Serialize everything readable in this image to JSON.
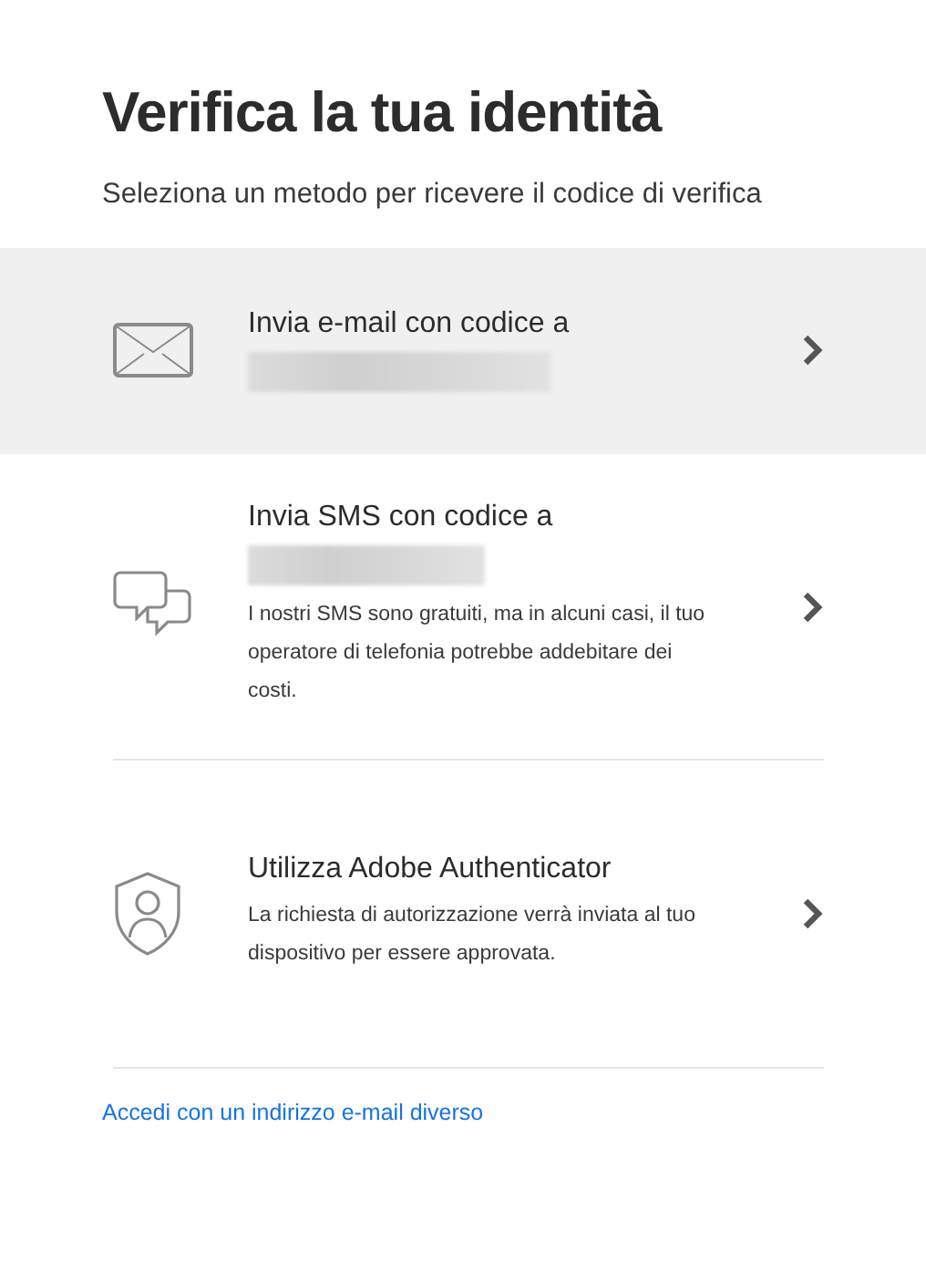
{
  "title": "Verifica la tua identità",
  "subtitle": "Seleziona un metodo per ricevere il codice di verifica",
  "options": [
    {
      "kind": "email",
      "selected": true,
      "label": "Invia e-mail con codice a",
      "redacted": true
    },
    {
      "kind": "sms",
      "selected": false,
      "label": "Invia SMS con codice a",
      "redacted": true,
      "note": "I nostri SMS sono gratuiti, ma in alcuni casi, il tuo operatore di telefonia potrebbe addebitare dei costi."
    },
    {
      "kind": "authenticator",
      "selected": false,
      "label": "Utilizza Adobe Authenticator",
      "redacted": false,
      "note": "La richiesta di autorizzazione verrà inviata al tuo dispositivo per essere approvata."
    }
  ],
  "link": "Accedi con un indirizzo e-mail diverso"
}
